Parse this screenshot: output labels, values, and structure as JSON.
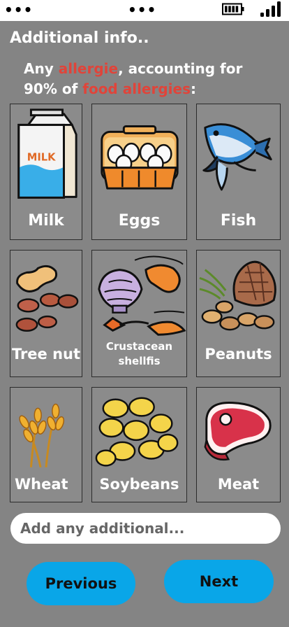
{
  "title": "Additional info..",
  "subtitle": {
    "p1": "Any ",
    "hl1": "allergie",
    "p2": ", accounting for",
    "p3": "90% of ",
    "hl2": "food allergies",
    "p4": ":"
  },
  "colors": {
    "background": "#848484",
    "accent_text": "#e0443a",
    "button": "#09a6e8"
  },
  "status_bar": {
    "left_icon": "more-dots",
    "center_icon": "more-dots",
    "battery_icon": "battery",
    "signal_icon": "signal-bars"
  },
  "allergens": [
    {
      "label": "Milk",
      "icon": "milk-carton-icon",
      "art_text": "MILK"
    },
    {
      "label": "Eggs",
      "icon": "egg-carton-icon"
    },
    {
      "label": "Fish",
      "icon": "fish-icon"
    },
    {
      "label": "Tree nut",
      "icon": "tree-nut-icon"
    },
    {
      "label": "Crustacean shellfis",
      "line1": "Crustacean",
      "line2": "shellfis",
      "icon": "shrimp-shell-icon"
    },
    {
      "label": "Peanuts",
      "icon": "pinecone-nuts-icon"
    },
    {
      "label": "Wheat",
      "icon": "wheat-icon"
    },
    {
      "label": "Soybeans",
      "icon": "soybeans-icon"
    },
    {
      "label": "Meat",
      "icon": "steak-icon"
    }
  ],
  "additional_input": {
    "placeholder": "Add any additional..."
  },
  "buttons": {
    "previous": "Previous",
    "next": "Next"
  }
}
